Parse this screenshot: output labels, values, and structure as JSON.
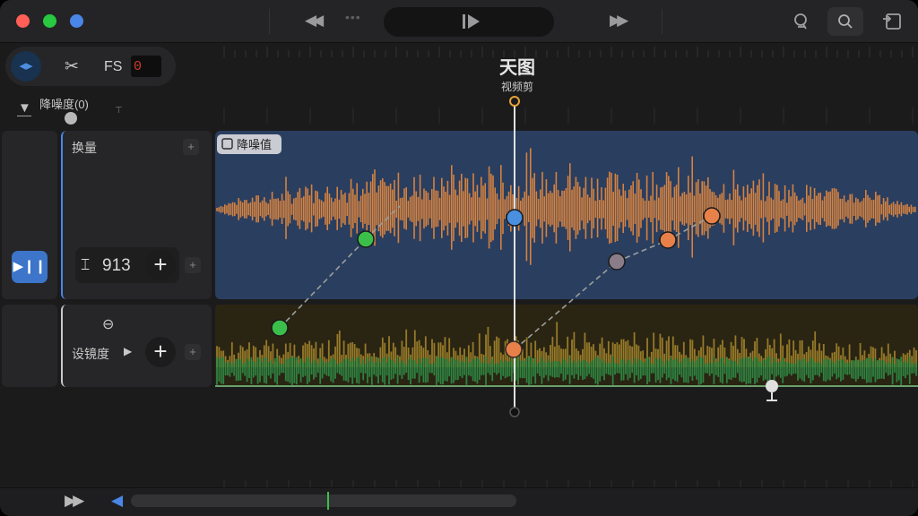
{
  "titlebar": {
    "traffic_lights": [
      "#ff5f57",
      "#28c840",
      "#4a86e8"
    ],
    "icons": [
      "rewind-icon",
      "more-dots-icon",
      "play-icon",
      "fast-forward-icon",
      "voice-icon",
      "search-icon",
      "export-icon"
    ]
  },
  "header": {
    "fs_label": "FS",
    "counter_value": "0",
    "param_label": "降噪度(0)"
  },
  "playhead": {
    "title": "天图",
    "subtitle": "视频剪"
  },
  "tracks": [
    {
      "name": "换量",
      "value_label": "913",
      "clip_label": "降噪值",
      "clip_color": "#2a3e60",
      "wave_color": "#e88a3c"
    },
    {
      "name": "设镜度",
      "wave_colors": [
        "#2f8d45",
        "#a98a2c"
      ]
    }
  ],
  "colors": {
    "accent": "#4a86e8",
    "keyframe_green": "#3cbf4a",
    "keyframe_orange": "#e8804a",
    "keyframe_blue": "#4a8fe0",
    "keyframe_gray": "#8a7c88"
  },
  "bottom": {
    "scroll_position": 0.51
  }
}
